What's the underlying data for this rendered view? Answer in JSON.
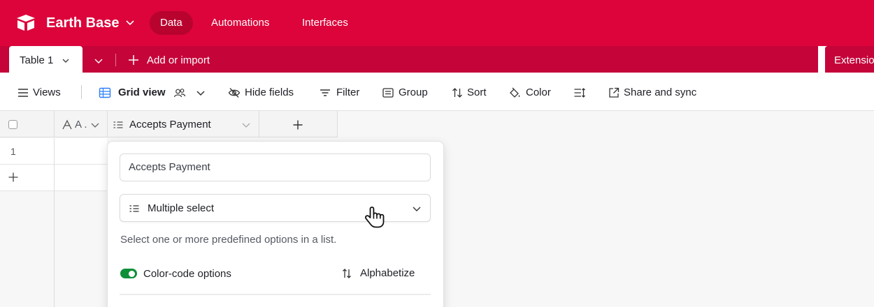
{
  "header": {
    "base_name": "Earth Base",
    "nav": [
      {
        "label": "Data",
        "active": true
      },
      {
        "label": "Automations",
        "active": false
      },
      {
        "label": "Interfaces",
        "active": false
      }
    ],
    "brand_color": "#dc043b"
  },
  "tabs": {
    "active_table": "Table 1",
    "add_label": "Add or import",
    "extensions_label": "Extensio"
  },
  "toolbar": {
    "views": "Views",
    "grid_view": "Grid view",
    "hide_fields": "Hide fields",
    "filter": "Filter",
    "group": "Group",
    "sort": "Sort",
    "color": "Color",
    "share": "Share and sync"
  },
  "grid": {
    "col1_label": "A .",
    "col2_label": "Accepts Payment",
    "rows": [
      "1"
    ]
  },
  "field_editor": {
    "name_value": "Accepts Payment",
    "type_label": "Multiple select",
    "description": "Select one or more predefined options in a list.",
    "color_code_label": "Color-code options",
    "color_code_on": true,
    "alphabetize_label": "Alphabetize",
    "toggle_color": "#0d8f38"
  }
}
